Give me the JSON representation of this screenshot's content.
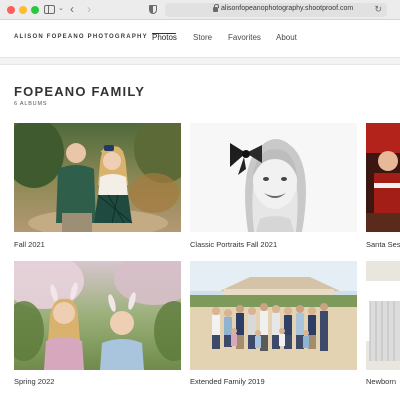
{
  "browser": {
    "url": "alisonfopeanophotography.shootproof.com"
  },
  "site": {
    "logo": "ALISON FOPEANO PHOTOGRAPHY",
    "nav": [
      {
        "label": "Photos"
      },
      {
        "label": "Store"
      },
      {
        "label": "Favorites"
      },
      {
        "label": "About"
      }
    ]
  },
  "gallery": {
    "title": "FOPEANO FAMILY",
    "count": "6 ALBUMS",
    "albums": [
      {
        "title": "Fall 2021"
      },
      {
        "title": "Classic Portraits Fall 2021"
      },
      {
        "title": "Santa Sess"
      },
      {
        "title": "Spring 2022"
      },
      {
        "title": "Extended Family 2019"
      },
      {
        "title": "Newborn"
      }
    ]
  },
  "colors": {
    "close": "#fe5f57",
    "minimize": "#febc2e",
    "zoom": "#28c840"
  }
}
